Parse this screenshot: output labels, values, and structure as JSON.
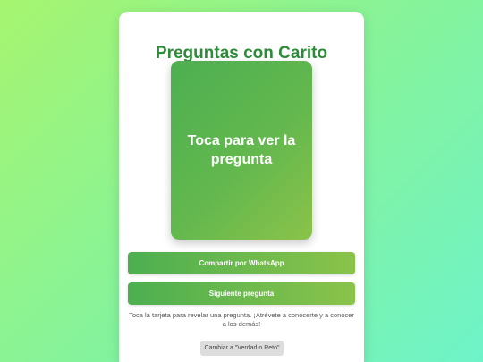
{
  "app": {
    "title": "Preguntas con Carito"
  },
  "card": {
    "prompt": "Toca para ver la pregunta"
  },
  "actions": {
    "share_label": "Compartir por WhatsApp",
    "next_label": "Siguiente pregunta",
    "switch_mode_label": "Cambiar a \"Verdad o Reto\""
  },
  "hint": "Toca la tarjeta para revelar una pregunta. ¡Atrévete a conocerte y a conocer a los demás!",
  "colors": {
    "primary_green": "#4caf50",
    "accent_green": "#8bc34a",
    "title_green": "#2e8b3a",
    "switch_button_bg": "#dddddd"
  }
}
